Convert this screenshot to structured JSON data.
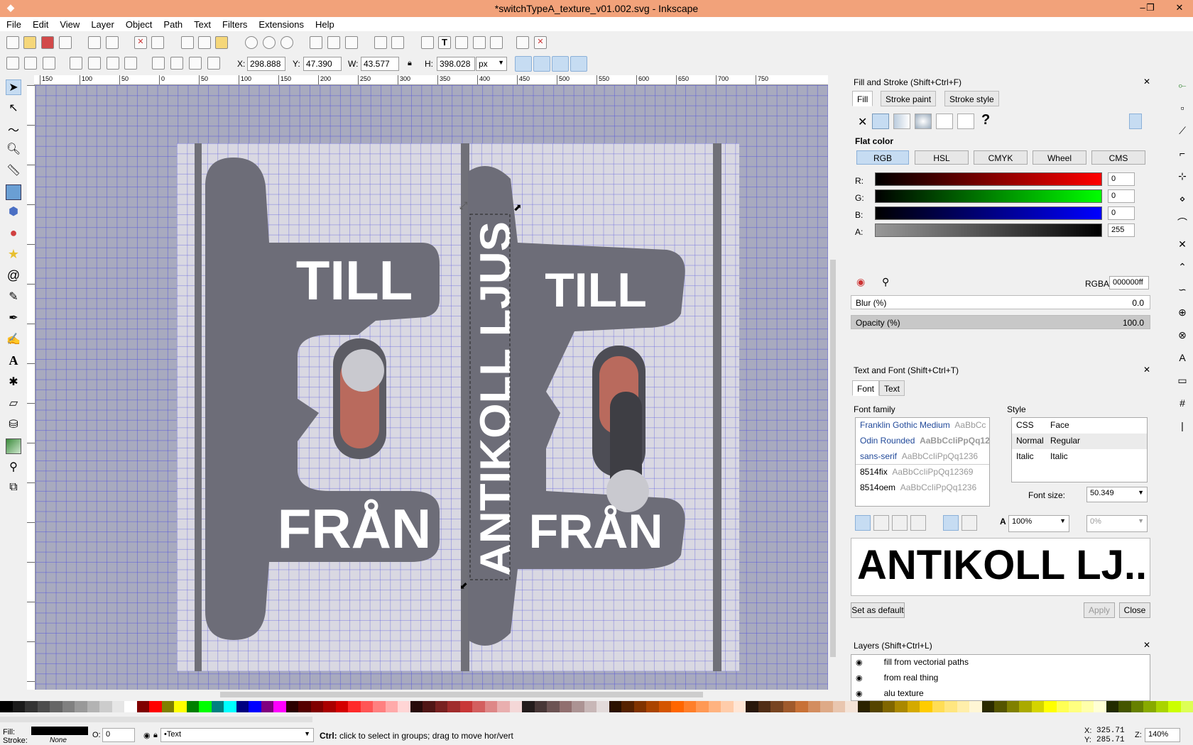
{
  "window": {
    "title": "*switchTypeA_texture_v01.002.svg - Inkscape",
    "controls": [
      "‒",
      "❐",
      "✕"
    ]
  },
  "menu": [
    "File",
    "Edit",
    "View",
    "Layer",
    "Object",
    "Path",
    "Text",
    "Filters",
    "Extensions",
    "Help"
  ],
  "controls_bar": {
    "x_label": "X:",
    "x": "298.888",
    "y_label": "Y:",
    "y": "47.390",
    "w_label": "W:",
    "w": "43.577",
    "h_label": "H:",
    "h": "398.028",
    "unit": "px"
  },
  "ruler_ticks": [
    "150",
    "100",
    "50",
    "0",
    "50",
    "100",
    "150",
    "200",
    "250",
    "300",
    "350",
    "400",
    "450",
    "500",
    "550",
    "600",
    "650",
    "700",
    "750"
  ],
  "canvas_text": {
    "till": "TILL",
    "fran": "FRÅN",
    "antikoll": "ANTIKOLL LJUS"
  },
  "fill_stroke": {
    "title": "Fill and Stroke (Shift+Ctrl+F)",
    "tabs": [
      "Fill",
      "Stroke paint",
      "Stroke style"
    ],
    "mode": "Flat color",
    "color_modes": [
      "RGB",
      "HSL",
      "CMYK",
      "Wheel",
      "CMS"
    ],
    "channels": [
      {
        "label": "R:",
        "value": "0",
        "color": "#ff0000"
      },
      {
        "label": "G:",
        "value": "0",
        "color": "#00ff00"
      },
      {
        "label": "B:",
        "value": "0",
        "color": "#0000ff"
      },
      {
        "label": "A:",
        "value": "255",
        "color": "#000000"
      }
    ],
    "rgba_label": "RGBA:",
    "rgba": "000000ff",
    "blur_label": "Blur (%)",
    "blur": "0.0",
    "opacity_label": "Opacity (%)",
    "opacity": "100.0"
  },
  "text_font": {
    "title": "Text and Font (Shift+Ctrl+T)",
    "tabs": [
      "Font",
      "Text"
    ],
    "family_label": "Font family",
    "families": [
      {
        "name": "Franklin Gothic Medium",
        "sample": "AaBbCc"
      },
      {
        "name": "Odin Rounded",
        "sample": "AaBbCcIiPpQq123"
      },
      {
        "name": "sans-serif",
        "sample": "AaBbCcIiPpQq1236"
      },
      {
        "name": "8514fix",
        "sample": "AaBbCcIiPpQq12369"
      },
      {
        "name": "8514oem",
        "sample": "AaBbCcIiPpQq1236"
      }
    ],
    "style_label": "Style",
    "style_header": {
      "css": "CSS",
      "face": "Face"
    },
    "styles": [
      {
        "css": "Normal",
        "face": "Regular"
      },
      {
        "css": "Italic",
        "face": "Italic"
      }
    ],
    "size_label": "Font size:",
    "size": "50.349",
    "spacing": "100%",
    "kerning": "0%",
    "preview": "ANTIKOLL LJ...",
    "set_default": "Set as default",
    "apply": "Apply",
    "close": "Close"
  },
  "layers": {
    "title": "Layers (Shift+Ctrl+L)",
    "items": [
      "fill from vectorial paths",
      "from real thing",
      "alu texture"
    ]
  },
  "status": {
    "fill_label": "Fill:",
    "stroke_label": "Stroke:",
    "stroke_value": "None",
    "opacity_label": "O:",
    "opacity_value": "0",
    "layer": "•Text",
    "message_bold": "Ctrl:",
    "message": " click to select in groups; drag to move hor/vert",
    "x_label": "X:",
    "x": "325.71",
    "y_label": "Y:",
    "y": "285.71",
    "zoom_label": "Z:",
    "zoom": "140%"
  },
  "colors": {
    "titlebar": "#f2a27a",
    "accent": "#c6dcf2",
    "canvas_bg": "#a8aabf",
    "switch_plate": "#6d6d78"
  }
}
